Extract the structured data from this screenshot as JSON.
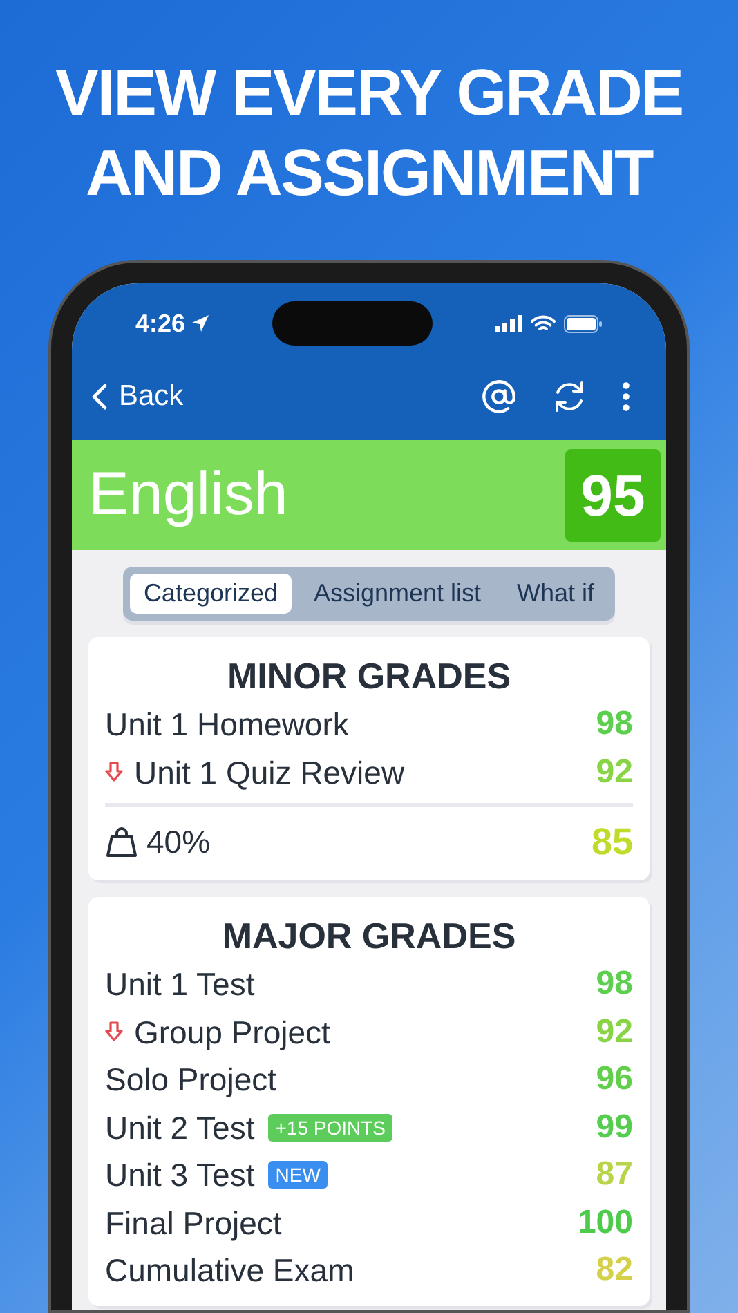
{
  "headline": [
    "VIEW EVERY GRADE",
    "AND ASSIGNMENT"
  ],
  "status_bar": {
    "time": "4:26"
  },
  "nav": {
    "back": "Back"
  },
  "course": {
    "name": "English",
    "grade": "95"
  },
  "tabs": [
    {
      "label": "Categorized",
      "selected": true
    },
    {
      "label": "Assignment list",
      "selected": false
    },
    {
      "label": "What if",
      "selected": false
    }
  ],
  "categories": [
    {
      "title": "MINOR GRADES",
      "assignments": [
        {
          "name": "Unit 1 Homework",
          "grade": "98",
          "color": "#5ccf4f",
          "dropped": false
        },
        {
          "name": "Unit 1 Quiz Review",
          "grade": "92",
          "color": "#88d445",
          "dropped": true
        }
      ],
      "weight": {
        "percent": "40%",
        "grade": "85",
        "color": "#c1db2a"
      }
    },
    {
      "title": "MAJOR GRADES",
      "assignments": [
        {
          "name": "Unit 1 Test",
          "grade": "98",
          "color": "#5ccf4f",
          "dropped": false
        },
        {
          "name": "Group Project",
          "grade": "92",
          "color": "#88d445",
          "dropped": true
        },
        {
          "name": "Solo Project",
          "grade": "96",
          "color": "#62cf4c",
          "dropped": false
        },
        {
          "name": "Unit 2 Test",
          "grade": "99",
          "color": "#55cd4f",
          "dropped": false,
          "badge": {
            "text": "+15 POINTS",
            "color": "#5ccc5a"
          }
        },
        {
          "name": "Unit 3 Test",
          "grade": "87",
          "color": "#b8d448",
          "dropped": false,
          "badge": {
            "text": "NEW",
            "color": "#3a8ef0"
          }
        },
        {
          "name": "Final Project",
          "grade": "100",
          "color": "#4fcb4c",
          "dropped": false
        },
        {
          "name": "Cumulative Exam",
          "grade": "82",
          "color": "#d4d04a",
          "dropped": false
        }
      ]
    }
  ]
}
